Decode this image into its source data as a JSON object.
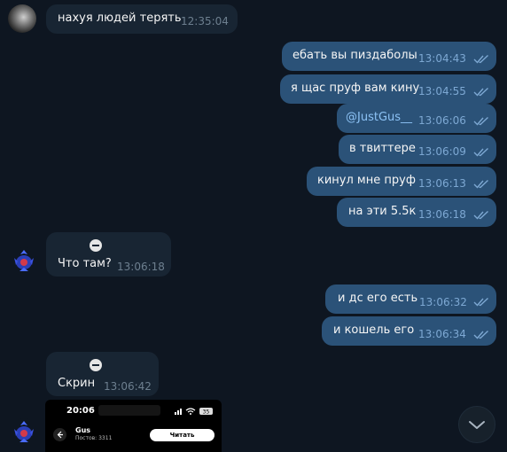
{
  "messages": [
    {
      "id": "m1",
      "dir": "in",
      "text": "нахуя людей терять",
      "time": "12:35:04"
    },
    {
      "id": "m2",
      "dir": "out",
      "text": "ебать вы пиздаболы",
      "time": "13:04:43"
    },
    {
      "id": "m3",
      "dir": "out",
      "text": "я щас пруф вам кину",
      "time": "13:04:55"
    },
    {
      "id": "m4",
      "dir": "out",
      "text": "@JustGus__",
      "time": "13:06:06"
    },
    {
      "id": "m5",
      "dir": "out",
      "text": "в твиттере",
      "time": "13:06:09"
    },
    {
      "id": "m6",
      "dir": "out",
      "text": "кинул мне пруф",
      "time": "13:06:13"
    },
    {
      "id": "m7",
      "dir": "out",
      "text": "на эти 5.5к",
      "time": "13:06:18"
    },
    {
      "id": "m8",
      "dir": "in",
      "text": "Что там?",
      "time": "13:06:18"
    },
    {
      "id": "m9",
      "dir": "out",
      "text": "и дс его есть",
      "time": "13:06:32"
    },
    {
      "id": "m10",
      "dir": "out",
      "text": "и кошель его",
      "time": "13:06:34"
    },
    {
      "id": "m11",
      "dir": "in",
      "text": "Скрин",
      "time": "13:06:42"
    }
  ],
  "screenshot": {
    "time": "20:06",
    "battery": "35",
    "name": "Gus",
    "subtitle": "Постов: 3311",
    "button": "Читать"
  },
  "icons": {
    "read_ticks": "double-check-icon",
    "scroll_down": "chevron-down-icon",
    "special_marker": "minus-circle-icon"
  },
  "colors": {
    "background": "#0e1621",
    "incoming_bubble": "#182533",
    "outgoing_bubble": "#2b5278",
    "mention": "#8cc2f5"
  }
}
